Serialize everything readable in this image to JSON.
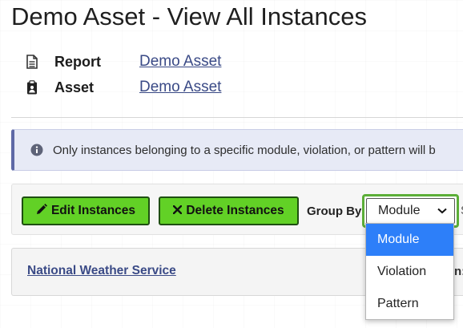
{
  "page": {
    "title": "Demo Asset - View All Instances"
  },
  "meta": {
    "report": {
      "icon": "document-icon",
      "label": "Report",
      "value": "Demo Asset"
    },
    "asset": {
      "icon": "clipboard-icon",
      "label": "Asset",
      "value": "Demo Asset"
    }
  },
  "alert": {
    "icon": "info-circle-icon",
    "text": "Only instances belonging to a specific module, violation, or pattern will b"
  },
  "toolbar": {
    "edit_label": "Edit Instances",
    "edit_icon": "pencil-icon",
    "delete_label": "Delete Instances",
    "delete_icon": "x-icon",
    "group_by_label": "Group By",
    "group_by_value": "Module",
    "edge_char": "S"
  },
  "dropdown": {
    "options": [
      {
        "label": "Module",
        "selected": true
      },
      {
        "label": "Violation",
        "selected": false
      },
      {
        "label": "Pattern",
        "selected": false
      }
    ]
  },
  "panel": {
    "title": "National Weather Service",
    "edge_text": "n:"
  },
  "colors": {
    "button_green": "#62d126",
    "link_blue": "#3a4a86",
    "alert_bg": "#e7eaf6",
    "selected_option": "#2d7ff9"
  }
}
